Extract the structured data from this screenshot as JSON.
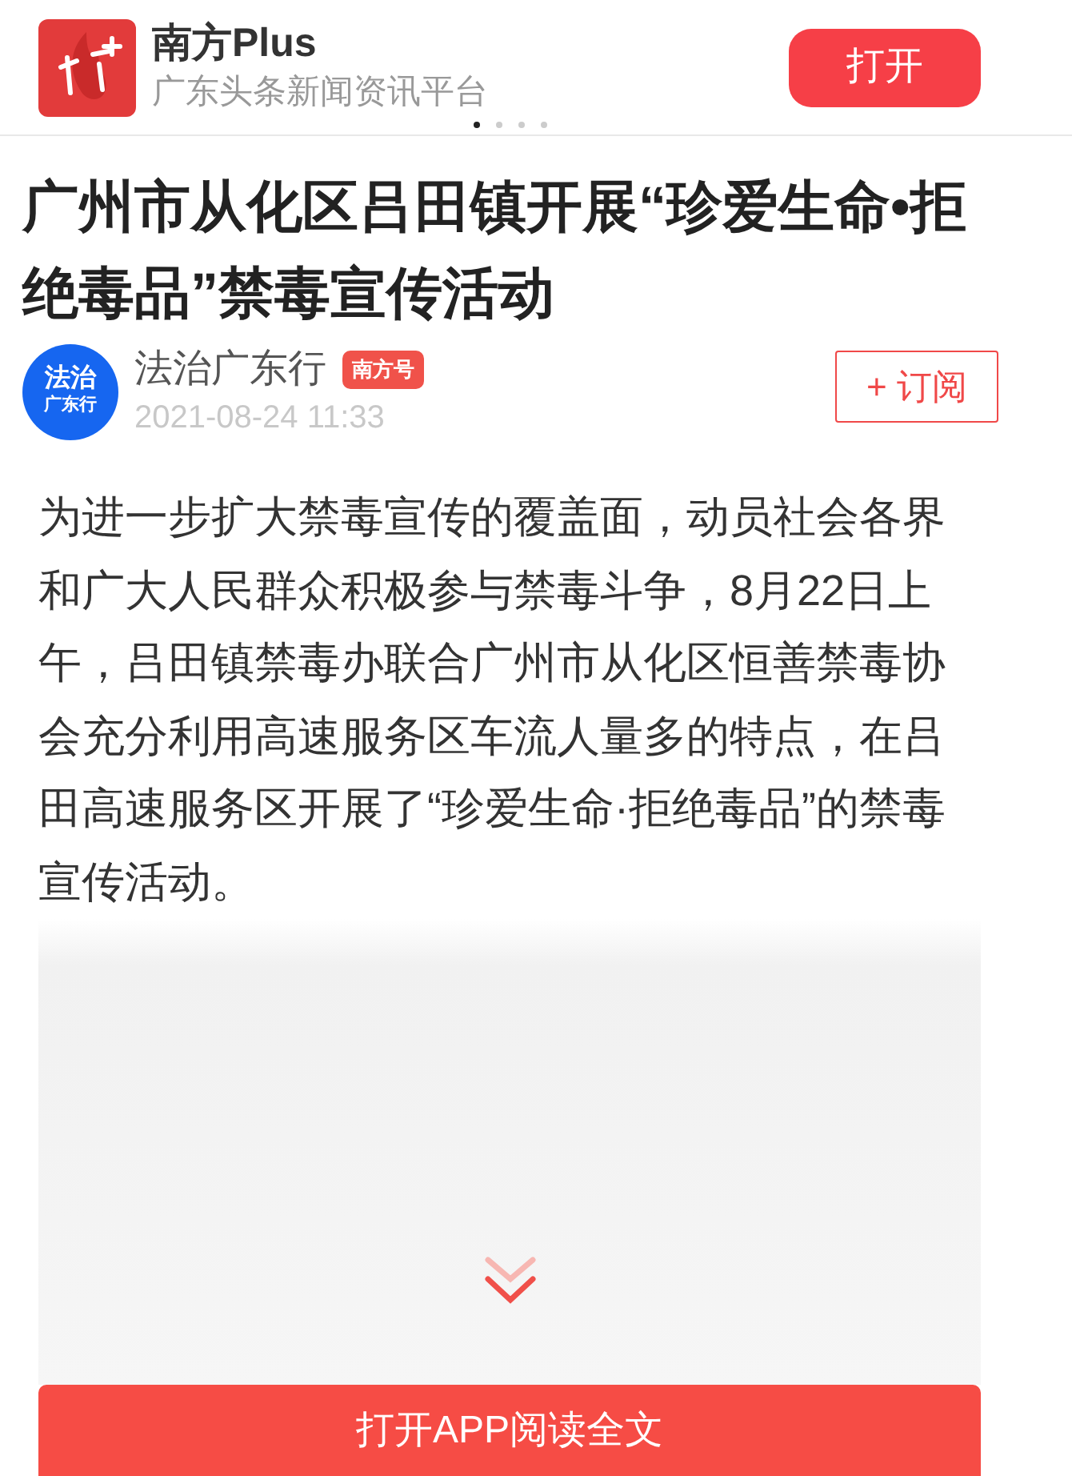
{
  "app_banner": {
    "name": "南方Plus",
    "tagline": "广东头条新闻资讯平台",
    "open_button": "打开",
    "page_dots": [
      {
        "selected": true
      },
      {
        "selected": false
      },
      {
        "selected": false
      },
      {
        "selected": false
      }
    ]
  },
  "article": {
    "title": "广州市从化区吕田镇开展“珍爱生命•拒绝毒品”禁毒宣传活动",
    "author": {
      "avatar_lines": [
        "法治",
        "广东行"
      ],
      "name": "法治广东行",
      "badge": "南方号",
      "date": "2021-08-24 11:33",
      "subscribe_button": "+ 订阅"
    },
    "body": "为进一步扩大禁毒宣传的覆盖面，动员社会各界和广大人民群众积极参与禁毒斗争，8月22日上午，吕田镇禁毒办联合广州市从化区恒善禁毒协会充分利用高速服务区车流人量多的特点，在吕田高速服务区开展了“珍爱生命·拒绝毒品”的禁毒宣传活动。"
  },
  "read_more_button": "打开APP阅读全文"
}
